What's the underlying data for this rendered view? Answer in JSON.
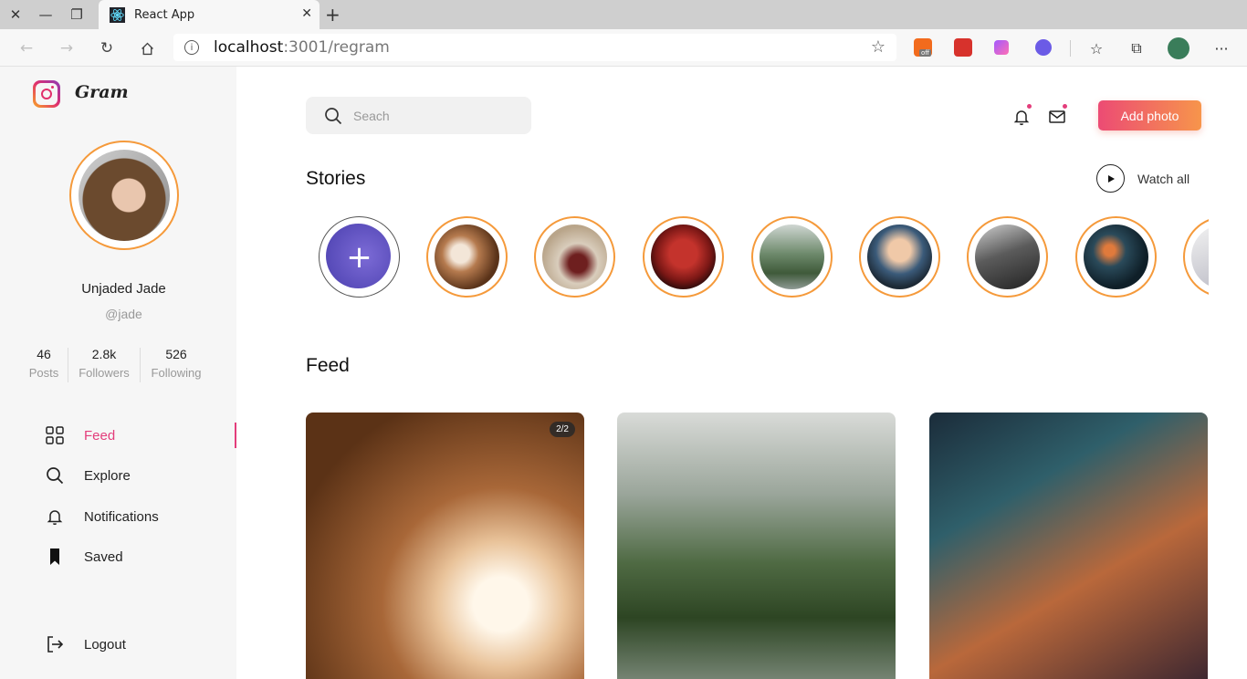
{
  "browser": {
    "tab_title": "React App",
    "url_host": "localhost",
    "url_path": ":3001/regram",
    "extension_badge": "off"
  },
  "app": {
    "brand": "Gram",
    "user": {
      "name": "Unjaded Jade",
      "handle": "@jade"
    },
    "stats": [
      {
        "value": "46",
        "label": "Posts"
      },
      {
        "value": "2.8k",
        "label": "Followers"
      },
      {
        "value": "526",
        "label": "Following"
      }
    ],
    "menu": [
      {
        "label": "Feed",
        "icon": "grid-icon",
        "active": true
      },
      {
        "label": "Explore",
        "icon": "search-icon",
        "active": false
      },
      {
        "label": "Notifications",
        "icon": "bell-icon",
        "active": false
      },
      {
        "label": "Saved",
        "icon": "bookmark-icon",
        "active": false
      }
    ],
    "logout_label": "Logout",
    "accent_color": "#e33d7b"
  },
  "header": {
    "search_placeholder": "Seach",
    "add_photo_label": "Add photo"
  },
  "stories": {
    "title": "Stories",
    "watch_all_label": "Watch all"
  },
  "feed": {
    "title": "Feed",
    "cards": [
      {
        "badge": "2/2"
      },
      {
        "badge": ""
      },
      {
        "badge": ""
      }
    ]
  }
}
